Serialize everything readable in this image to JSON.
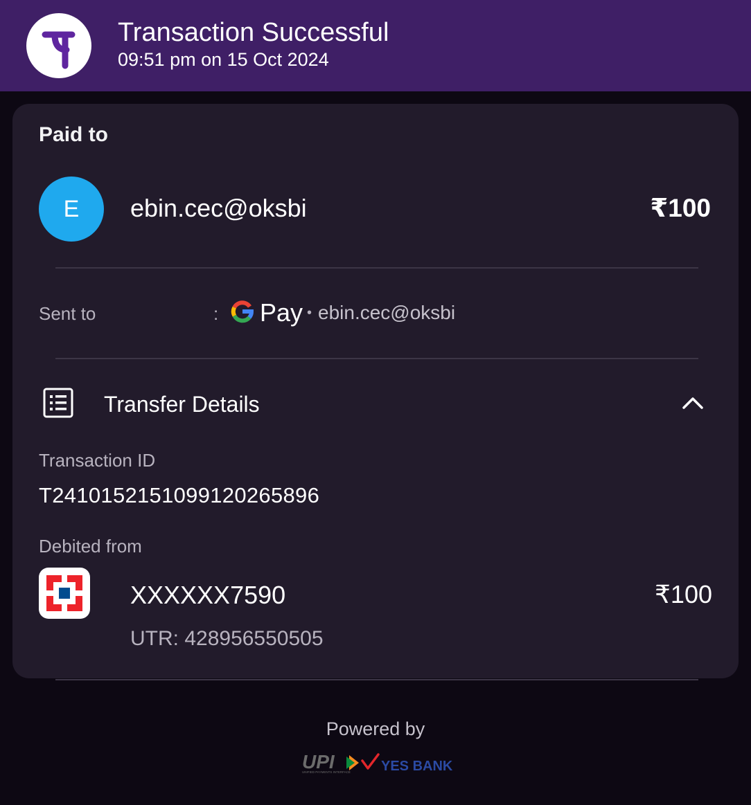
{
  "header": {
    "logo_icon": "phonepe-logo-icon",
    "title": "Transaction Successful",
    "subtitle": "09:51 pm on 15 Oct 2024",
    "background_color": "#3f1f66"
  },
  "card": {
    "paid_to_label": "Paid to",
    "payee": {
      "avatar_letter": "E",
      "avatar_color": "#1fa9ee",
      "vpa": "ebin.cec@oksbi",
      "amount": "₹100"
    },
    "sent_to": {
      "label": "Sent to",
      "separator": ":",
      "app_icon": "google-g-icon",
      "app_name": "Pay",
      "dot": "•",
      "vpa": "ebin.cec@oksbi"
    },
    "transfer_details": {
      "icon": "receipt-list-icon",
      "title": "Transfer Details",
      "toggle_icon": "chevron-up-icon",
      "transaction_id_label": "Transaction ID",
      "transaction_id": "T2410152151099120265896",
      "debited_from_label": "Debited from",
      "bank_icon": "hdfc-bank-logo-icon",
      "account": "XXXXXX7590",
      "amount": "₹100",
      "utr": "UTR: 428956550505"
    }
  },
  "footer": {
    "powered_by": "Powered by",
    "upi_logo_text": "UPI",
    "upi_tagline": "UNIFIED PAYMENTS INTERFACE",
    "bank_logo_text": "YES BANK"
  }
}
